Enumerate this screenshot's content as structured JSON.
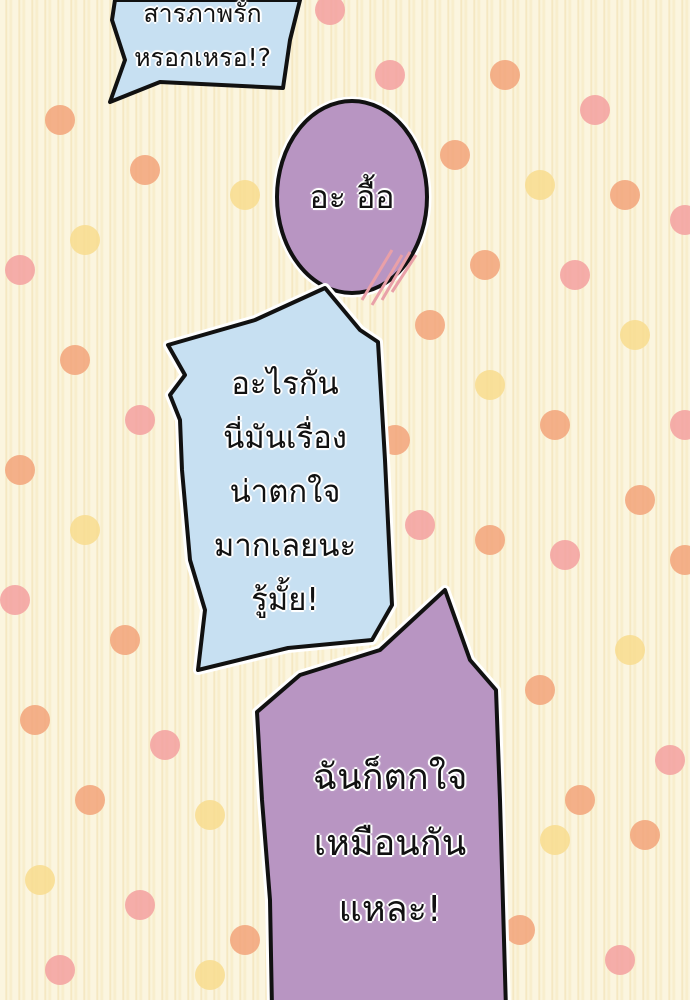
{
  "bubbles": [
    {
      "lines": [
        "สารภาพรัก",
        "หรอกเหรอ!?"
      ],
      "color": "#c7e0f2"
    },
    {
      "lines": [
        "อะ อื้อ"
      ],
      "color": "#b895c2"
    },
    {
      "lines": [
        "อะไรกัน",
        "นี่มันเรื่อง",
        "น่าตกใจ",
        "มากเลยนะ",
        "รู้มั้ย!"
      ],
      "color": "#c7e0f2"
    },
    {
      "lines": [
        "ฉันก็ตกใจ",
        "เหมือนกัน",
        "แหละ!"
      ],
      "color": "#b895c2"
    }
  ],
  "colors": {
    "background": "#fbf5df",
    "dot_orange": "#f2a37a",
    "dot_pink": "#f3a0a0",
    "dot_yellow": "#f8dc8e"
  }
}
